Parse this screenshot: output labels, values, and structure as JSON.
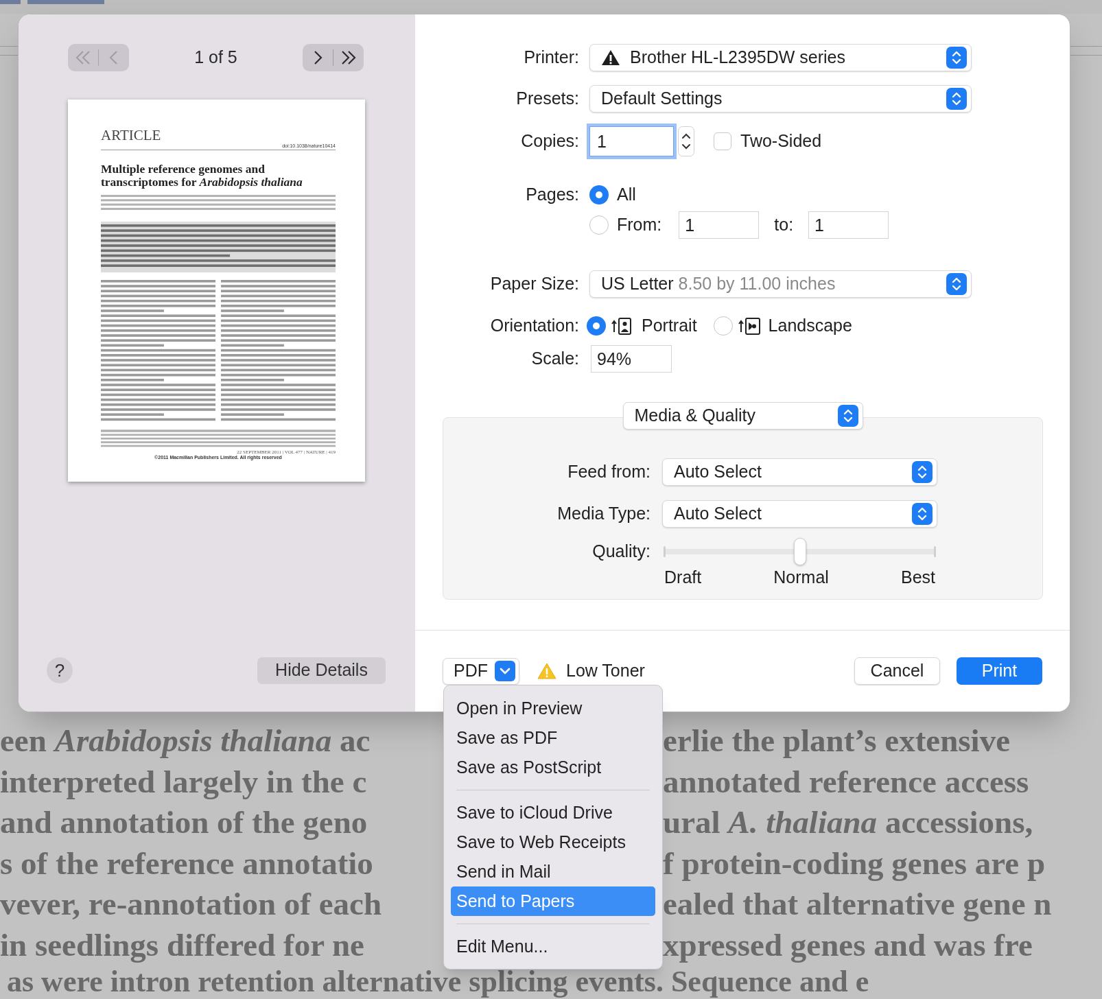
{
  "background": {
    "lines": [
      {
        "left": "een *Arabidopsis thaliana* ac",
        "right": "erlie the plant’s extensive"
      },
      {
        "left": "interpreted largely in the c",
        "right": "annotated reference access"
      },
      {
        "left": "and annotation of the geno",
        "right": "ural *A. thaliana* accessions,"
      },
      {
        "left": "s of the reference annotatio",
        "right": "f protein-coding genes are p"
      },
      {
        "left": "vever, re-annotation of each",
        "right": "ealed that alternative gene n"
      },
      {
        "left": "in seedlings differed for ne",
        "right": "xpressed genes and was fre"
      }
    ],
    "last_line": "as were intron retention alternative splicing events. Sequence and e"
  },
  "preview": {
    "back_buttons": {
      "disabled": true
    },
    "page_indicator": "1 of 5",
    "forward_buttons": {
      "disabled": false
    },
    "page": {
      "heading": "ARTICLE",
      "doi": "doi:10.1038/nature10414",
      "title": "Multiple reference genomes and transcriptomes for *Arabidopsis thaliana*",
      "footer": "22 SEPTEMBER 2011 | VOL 477 | NATURE | 419",
      "copyright": "©2011 Macmillan Publishers Limited. All rights reserved"
    },
    "help_button": "?",
    "hide_details_button": "Hide Details"
  },
  "settings": {
    "printer": {
      "label": "Printer:",
      "value": "Brother HL-L2395DW series",
      "warning": true
    },
    "presets": {
      "label": "Presets:",
      "value": "Default Settings"
    },
    "copies": {
      "label": "Copies:",
      "value": "1",
      "focused": true
    },
    "two_sided": {
      "label": "Two-Sided",
      "checked": false
    },
    "pages": {
      "label": "Pages:",
      "options": [
        {
          "label": "All",
          "selected": true
        },
        {
          "label": "From:",
          "selected": false
        }
      ],
      "from": "1",
      "to_label": "to:",
      "to": "1"
    },
    "paper_size": {
      "label": "Paper Size:",
      "value": "US Letter",
      "detail": "8.50 by 11.00 inches"
    },
    "orientation": {
      "label": "Orientation:",
      "options": [
        {
          "label": "Portrait",
          "kind": "portrait",
          "selected": true
        },
        {
          "label": "Landscape",
          "kind": "landscape",
          "selected": false
        }
      ]
    },
    "scale": {
      "label": "Scale:",
      "value": "94%"
    }
  },
  "section": {
    "value": "Media & Quality",
    "fields": [
      {
        "label": "Feed from:",
        "value": "Auto Select"
      },
      {
        "label": "Media Type:",
        "value": "Auto Select"
      }
    ],
    "quality": {
      "label": "Quality:",
      "level": 0.5,
      "marks": [
        "Draft",
        "Normal",
        "Best"
      ]
    }
  },
  "footer": {
    "pdf_button": "PDF",
    "warning": "Low Toner",
    "buttons": [
      {
        "label": "Cancel",
        "kind": "secondary"
      },
      {
        "label": "Print",
        "kind": "default"
      }
    ]
  },
  "pdf_menu": {
    "groups": [
      {
        "items": [
          {
            "label": "Open in Preview",
            "selected": false
          },
          {
            "label": "Save as PDF",
            "selected": false
          },
          {
            "label": "Save as PostScript",
            "selected": false
          }
        ]
      },
      {
        "items": [
          {
            "label": "Save to iCloud Drive",
            "selected": false
          },
          {
            "label": "Save to Web Receipts",
            "selected": false
          },
          {
            "label": "Send in Mail",
            "selected": false
          },
          {
            "label": "Send to Papers",
            "selected": true
          }
        ]
      },
      {
        "items": [
          {
            "label": "Edit Menu...",
            "selected": false
          }
        ]
      }
    ]
  }
}
